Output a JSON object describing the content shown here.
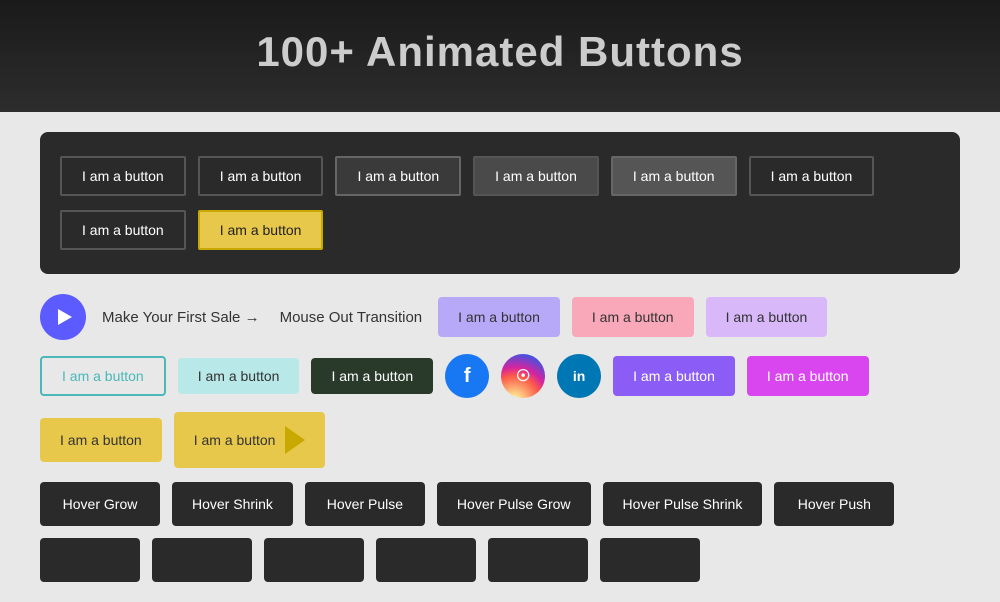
{
  "header": {
    "title": "100+ Animated Buttons"
  },
  "dark_section": {
    "rows": [
      {
        "buttons": [
          {
            "label": "I am a button",
            "style": "outline"
          },
          {
            "label": "I am a button",
            "style": "outline"
          },
          {
            "label": "I am a button",
            "style": "filled1"
          },
          {
            "label": "I am a button",
            "style": "filled2"
          },
          {
            "label": "I am a button",
            "style": "filled3"
          },
          {
            "label": "I am a button",
            "style": "outline"
          }
        ]
      },
      {
        "buttons": [
          {
            "label": "I am a button",
            "style": "outline"
          },
          {
            "label": "I am a button",
            "style": "yellow"
          }
        ]
      }
    ]
  },
  "mixed_rows": {
    "row1": {
      "play_button": {
        "label": "play"
      },
      "make_sale": {
        "label": "Make Your First Sale →"
      },
      "mouse_out": {
        "label": "Mouse Out Transition"
      },
      "purple_btn": {
        "label": "I am a button"
      },
      "pink_btn": {
        "label": "I am a button"
      },
      "lavender_btn": {
        "label": "I am a button"
      }
    },
    "row2": {
      "teal_btn": {
        "label": "I am a button"
      },
      "light_teal_btn": {
        "label": "I am a button"
      },
      "dark_green_btn": {
        "label": "I am a button"
      },
      "fb_icon": {
        "label": "f"
      },
      "ig_icon": {
        "label": "◯"
      },
      "li_icon": {
        "label": "in"
      },
      "purple_btn": {
        "label": "I am a button"
      },
      "magenta_btn": {
        "label": "I am a button"
      }
    },
    "row3": {
      "yellow_plain": {
        "label": "I am a button"
      },
      "yellow_arrow": {
        "label": "I am a button"
      }
    }
  },
  "hover_buttons": {
    "items": [
      {
        "label": "Hover Grow"
      },
      {
        "label": "Hover Shrink"
      },
      {
        "label": "Hover Pulse"
      },
      {
        "label": "Hover Pulse Grow"
      },
      {
        "label": "Hover Pulse Shrink"
      },
      {
        "label": "Hover Push"
      }
    ]
  },
  "bottom_buttons": {
    "items": [
      {
        "label": ""
      },
      {
        "label": ""
      },
      {
        "label": ""
      },
      {
        "label": ""
      },
      {
        "label": ""
      },
      {
        "label": ""
      }
    ]
  }
}
